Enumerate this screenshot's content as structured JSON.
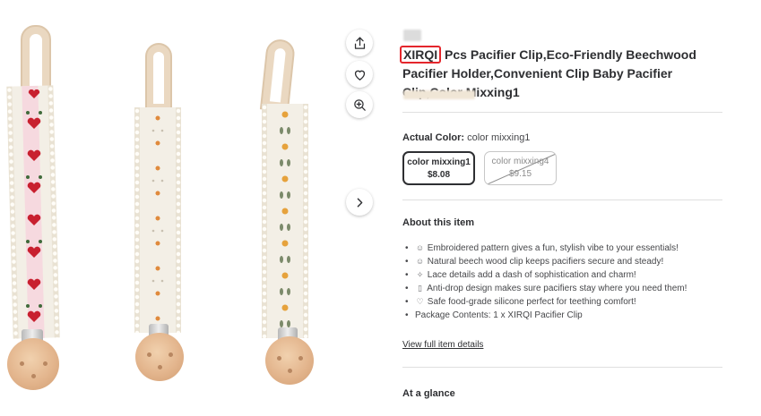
{
  "gallery": {
    "icons": [
      "share-icon",
      "heart-icon",
      "zoom-in-icon",
      "chevron-right-icon"
    ],
    "colors": {
      "strap": "#ead8c1",
      "wood": "#e3b58d",
      "red_motif": "#c8202f",
      "orange_motif": "#e6a23c"
    }
  },
  "product": {
    "brand": "XIRQI",
    "title_rest": "Pcs Pacifier Clip,Eco-Friendly Beechwood Pacifier Holder,Convenient Clip Baby Pacifier Clip,Color Mixxing1"
  },
  "variant": {
    "label": "Actual Color:",
    "value": "color mixxing1",
    "options": [
      {
        "name": "color mixxing1",
        "price": "$8.08",
        "selected": true
      },
      {
        "name": "color mixxing4",
        "price": "$9.15",
        "selected": false
      }
    ]
  },
  "about": {
    "heading": "About this item",
    "bullets": [
      {
        "icon": "smile-icon",
        "text": "Embroidered pattern gives a fun, stylish vibe to your essentials!"
      },
      {
        "icon": "smile-icon",
        "text": "Natural beech wood clip keeps pacifiers secure and steady!"
      },
      {
        "icon": "sparkle-icon",
        "text": "Lace details add a dash of sophistication and charm!"
      },
      {
        "icon": "bottle-icon",
        "text": "Anti-drop design makes sure pacifiers stay where you need them!"
      },
      {
        "icon": "heart-icon",
        "text": "Safe food-grade silicone perfect for teething comfort!"
      },
      {
        "icon": "",
        "text": "Package Contents: 1 x XIRQI Pacifier Clip"
      }
    ],
    "link": "View full item details"
  },
  "glance": {
    "heading": "At a glance"
  },
  "accent": "#e4262c"
}
